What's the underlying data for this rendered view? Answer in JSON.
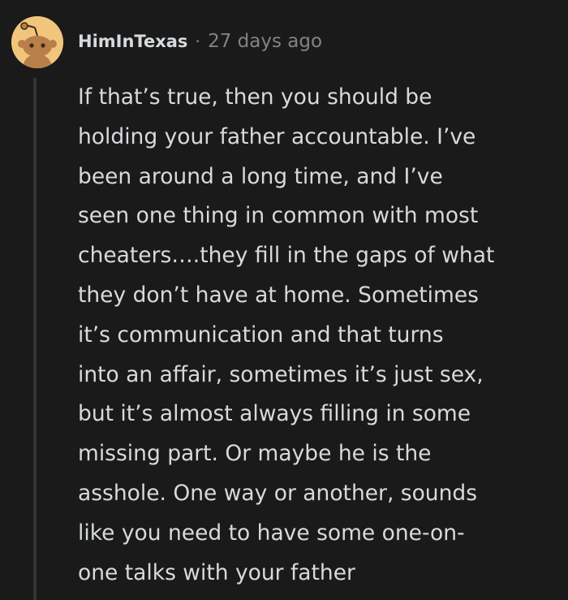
{
  "comment": {
    "author": "HimInTexas",
    "separator": "·",
    "age": "27 days ago",
    "avatar_icon": "snoo-avatar-icon",
    "avatar_bg": "#f2c57c",
    "body_lines": [
      "If that’s true, then you should be",
      "holding your father accountable. I’ve",
      "been around a long time, and I’ve",
      "seen one thing in common with most",
      "cheaters….they fill in the gaps of what",
      "they don’t have at home. Sometimes",
      "it’s communication and that turns",
      "into an affair, sometimes it’s just sex,",
      "but it’s almost always filling in some",
      "missing part. Or maybe he is the",
      "asshole. One way or another, sounds",
      "like you need to have some one-on-",
      "one talks with your father"
    ]
  },
  "colors": {
    "background": "#1a1a1b",
    "text": "#d7dadc",
    "meta": "#818384",
    "thread_line": "#343536"
  }
}
